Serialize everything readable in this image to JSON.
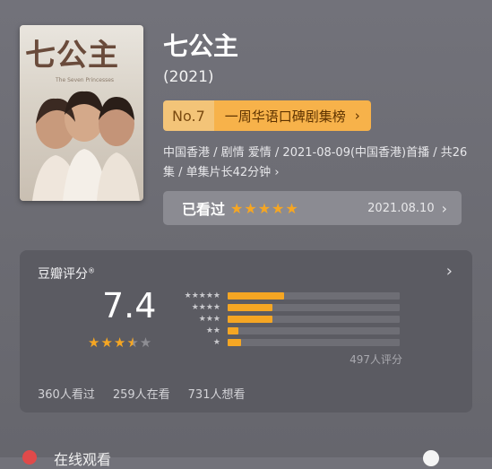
{
  "poster": {
    "title": "七公主",
    "subtitle": "The Seven Princesses"
  },
  "title": "七公主",
  "year": "(2021)",
  "rank": {
    "number": "No.7",
    "list": "一周华语口碑剧集榜",
    "chevron": "›"
  },
  "meta": "中国香港 / 剧情 爱情 / 2021-08-09(中国香港)首播 / 共26集 / 单集片长42分钟 ›",
  "watched": {
    "label": "已看过",
    "stars": "★★★★★",
    "date": "2021.08.10",
    "chevron": "›"
  },
  "rating": {
    "title": "豆瓣评分",
    "mark": "®",
    "chevron": "›",
    "score": "7.4",
    "stars_on": "★★★",
    "star_half": "★",
    "stars_off": "★",
    "distribution": [
      {
        "stars": "★★★★★",
        "fraction": 0.33
      },
      {
        "stars": "★★★★",
        "fraction": 0.26
      },
      {
        "stars": "★★★",
        "fraction": 0.26
      },
      {
        "stars": "★★",
        "fraction": 0.06
      },
      {
        "stars": "★",
        "fraction": 0.08
      }
    ],
    "count": "497人评分",
    "seen": "360人看过",
    "watching": "259人在看",
    "want": "731人想看"
  },
  "footer": {
    "text": "在线观看"
  },
  "colors": {
    "accent": "#f5a623",
    "rank_bg": "#f7b24a",
    "card_bg": "#5b5b62"
  }
}
